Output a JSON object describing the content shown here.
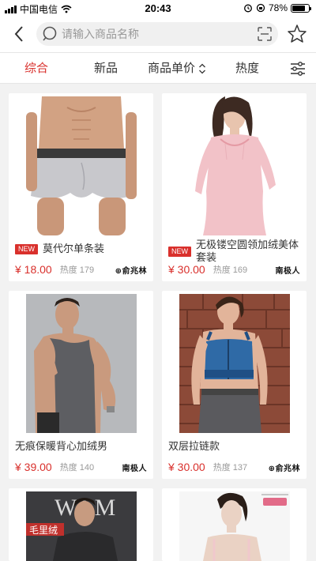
{
  "status_bar": {
    "carrier": "中国电信",
    "time": "20:43",
    "battery_percent": "78%",
    "battery_level": 0.78
  },
  "nav": {
    "back_icon": "chevron-left-icon",
    "search_placeholder": "请输入商品名称",
    "scan_icon": "scan-icon",
    "favorite_icon": "star-icon"
  },
  "filters": {
    "tabs": [
      {
        "label": "综合",
        "active": true
      },
      {
        "label": "新品",
        "active": false
      },
      {
        "label": "商品单价",
        "active": false,
        "sortable": true
      },
      {
        "label": "热度",
        "active": false
      }
    ],
    "filter_icon": "sliders-icon"
  },
  "products": [
    {
      "title": "莫代尔单条装",
      "new": true,
      "badge": "NEW",
      "price": "¥ 18.00",
      "heat": "热度 179",
      "brand": "⊕俞兆林"
    },
    {
      "title": "无极镂空圆领加绒美体套装",
      "new": true,
      "badge": "NEW",
      "price": "¥ 30.00",
      "heat": "热度 169",
      "brand": "南极人"
    },
    {
      "title": "无痕保暖背心加绒男",
      "new": false,
      "badge": "",
      "price": "¥ 39.00",
      "heat": "热度 140",
      "brand": "南极人"
    },
    {
      "title": "双层拉链款",
      "new": false,
      "badge": "",
      "price": "¥ 30.00",
      "heat": "热度 137",
      "brand": "⊕俞兆林"
    },
    {
      "title": "",
      "image_text": "毛里绒"
    },
    {
      "title": ""
    }
  ],
  "colors": {
    "accent": "#d9302c",
    "background": "#f2f2f2",
    "muted": "#999999"
  }
}
